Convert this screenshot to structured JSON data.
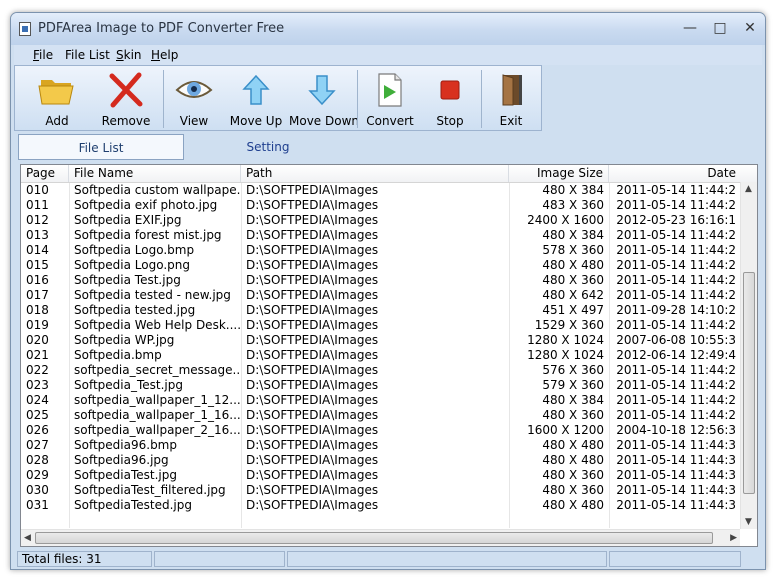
{
  "window": {
    "title": "PDFArea Image to PDF Converter Free"
  },
  "menu": [
    {
      "label": "File",
      "hotkey": "F",
      "rest": "ile"
    },
    {
      "label": "File List",
      "hotkey": "",
      "rest": "File List"
    },
    {
      "label": "Skin",
      "hotkey": "S",
      "rest": "kin"
    },
    {
      "label": "Help",
      "hotkey": "H",
      "rest": "elp"
    }
  ],
  "toolbar": {
    "add": "Add",
    "remove": "Remove",
    "view": "View",
    "move_up": "Move Up",
    "move_down": "Move Down",
    "convert": "Convert",
    "stop": "Stop",
    "exit": "Exit"
  },
  "tabs": {
    "file_list": "File List",
    "setting": "Setting"
  },
  "columns": [
    "Page",
    "File Name",
    "Path",
    "Image Size",
    "Date"
  ],
  "rows": [
    [
      "010",
      "Softpedia custom wallpape...",
      "D:\\SOFTPEDIA\\Images",
      "480 X 384",
      "2011-05-14 11:44:2"
    ],
    [
      "011",
      "Softpedia exif photo.jpg",
      "D:\\SOFTPEDIA\\Images",
      "483 X 360",
      "2011-05-14 11:44:2"
    ],
    [
      "012",
      "Softpedia EXIF.jpg",
      "D:\\SOFTPEDIA\\Images",
      "2400 X 1600",
      "2012-05-23 16:16:1"
    ],
    [
      "013",
      "Softpedia forest mist.jpg",
      "D:\\SOFTPEDIA\\Images",
      "480 X 384",
      "2011-05-14 11:44:2"
    ],
    [
      "014",
      "Softpedia Logo.bmp",
      "D:\\SOFTPEDIA\\Images",
      "578 X 360",
      "2011-05-14 11:44:2"
    ],
    [
      "015",
      "Softpedia Logo.png",
      "D:\\SOFTPEDIA\\Images",
      "480 X 480",
      "2011-05-14 11:44:2"
    ],
    [
      "016",
      "Softpedia Test.jpg",
      "D:\\SOFTPEDIA\\Images",
      "480 X 360",
      "2011-05-14 11:44:2"
    ],
    [
      "017",
      "Softpedia tested - new.jpg",
      "D:\\SOFTPEDIA\\Images",
      "480 X 642",
      "2011-05-14 11:44:2"
    ],
    [
      "018",
      "Softpedia tested.jpg",
      "D:\\SOFTPEDIA\\Images",
      "451 X 497",
      "2011-09-28 14:10:2"
    ],
    [
      "019",
      "Softpedia Web Help Desk....",
      "D:\\SOFTPEDIA\\Images",
      "1529 X 360",
      "2011-05-14 11:44:2"
    ],
    [
      "020",
      "Softpedia WP.jpg",
      "D:\\SOFTPEDIA\\Images",
      "1280 X 1024",
      "2007-06-08 10:55:3"
    ],
    [
      "021",
      "Softpedia.bmp",
      "D:\\SOFTPEDIA\\Images",
      "1280 X 1024",
      "2012-06-14 12:49:4"
    ],
    [
      "022",
      "softpedia_secret_message....",
      "D:\\SOFTPEDIA\\Images",
      "576 X 360",
      "2011-05-14 11:44:2"
    ],
    [
      "023",
      "Softpedia_Test.jpg",
      "D:\\SOFTPEDIA\\Images",
      "579 X 360",
      "2011-05-14 11:44:2"
    ],
    [
      "024",
      "softpedia_wallpaper_1_12...",
      "D:\\SOFTPEDIA\\Images",
      "480 X 384",
      "2011-05-14 11:44:2"
    ],
    [
      "025",
      "softpedia_wallpaper_1_16...",
      "D:\\SOFTPEDIA\\Images",
      "480 X 360",
      "2011-05-14 11:44:2"
    ],
    [
      "026",
      "softpedia_wallpaper_2_16...",
      "D:\\SOFTPEDIA\\Images",
      "1600 X 1200",
      "2004-10-18 12:56:3"
    ],
    [
      "027",
      "Softpedia96.bmp",
      "D:\\SOFTPEDIA\\Images",
      "480 X 480",
      "2011-05-14 11:44:3"
    ],
    [
      "028",
      "Softpedia96.jpg",
      "D:\\SOFTPEDIA\\Images",
      "480 X 480",
      "2011-05-14 11:44:3"
    ],
    [
      "029",
      "SoftpediaTest.jpg",
      "D:\\SOFTPEDIA\\Images",
      "480 X 360",
      "2011-05-14 11:44:3"
    ],
    [
      "030",
      "SoftpediaTest_filtered.jpg",
      "D:\\SOFTPEDIA\\Images",
      "480 X 360",
      "2011-05-14 11:44:3"
    ],
    [
      "031",
      "SoftpediaTested.jpg",
      "D:\\SOFTPEDIA\\Images",
      "480 X 480",
      "2011-05-14 11:44:3"
    ]
  ],
  "status": {
    "total_files": "Total files: 31"
  },
  "icons": {
    "add": "folder-open-icon",
    "remove": "red-x-icon",
    "view": "eye-icon",
    "move_up": "arrow-up-icon",
    "move_down": "arrow-down-icon",
    "convert": "convert-document-icon",
    "stop": "stop-icon",
    "exit": "exit-door-icon"
  },
  "colors": {
    "accent": "#3a78c8",
    "stop": "#d8311f",
    "remove": "#d42a1e",
    "folder": "#f0c440"
  }
}
